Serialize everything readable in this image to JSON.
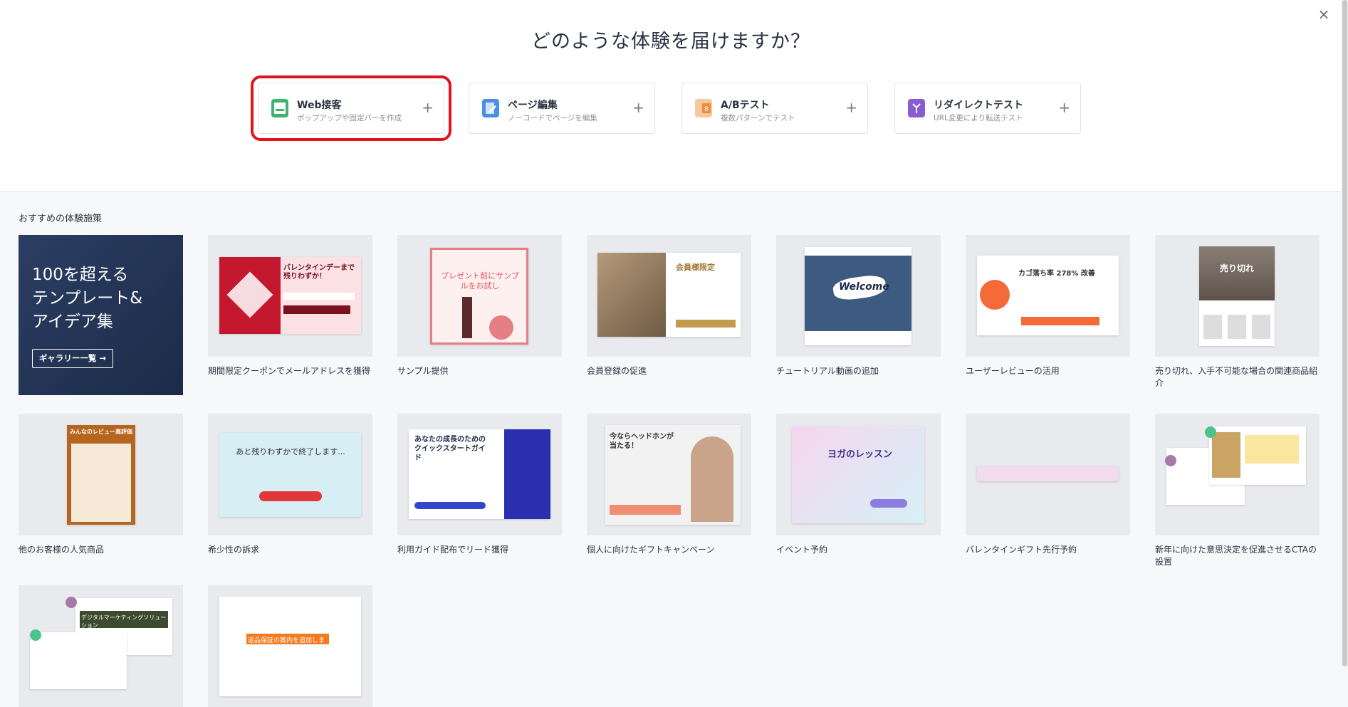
{
  "header": {
    "title": "どのような体験を届けますか？",
    "close_icon": "close-icon"
  },
  "experience_types": [
    {
      "label": "Web接客",
      "sub": "ポップアップや固定バーを作成",
      "icon": "popup-icon",
      "color": "#3cb371",
      "selected": true
    },
    {
      "label": "ページ編集",
      "sub": "ノーコードでページを編集",
      "icon": "page-edit-icon",
      "color": "#4a90e2",
      "selected": false
    },
    {
      "label": "A/Bテスト",
      "sub": "複数パターンでテスト",
      "icon": "ab-test-icon",
      "color": "#f08a3c",
      "selected": false
    },
    {
      "label": "リダイレクトテスト",
      "sub": "URL変更により転送テスト",
      "icon": "redirect-icon",
      "color": "#8a5cd1",
      "selected": false
    }
  ],
  "recommended": {
    "section_title": "おすすめの体験施策",
    "banner": {
      "text": "100を超える\nテンプレート&\nアイデア集",
      "button_label": "ギャラリー一覧 →"
    },
    "templates": [
      {
        "caption": "期間限定クーポンでメールアドレスを獲得",
        "thumb_text": "バレンタインデーまで残りわずか！"
      },
      {
        "caption": "サンプル提供",
        "thumb_text": "プレゼント前にサンプルをお試し"
      },
      {
        "caption": "会員登録の促進",
        "thumb_text": "会員様限定"
      },
      {
        "caption": "チュートリアル動画の追加",
        "thumb_text": "Welcome"
      },
      {
        "caption": "ユーザーレビューの活用",
        "thumb_text": "カゴ落ち率 278% 改善"
      },
      {
        "caption": "売り切れ、入手不可能な場合の関連商品紹介",
        "thumb_text": "売り切れ"
      },
      {
        "caption": "他のお客様の人気商品",
        "thumb_text": "みんなのレビュー高評価"
      },
      {
        "caption": "希少性の訴求",
        "thumb_text": "あと残りわずかで終了します..."
      },
      {
        "caption": "利用ガイド配布でリード獲得",
        "thumb_text": "あなたの成長のためのクイックスタートガイド"
      },
      {
        "caption": "個人に向けたギフトキャンペーン",
        "thumb_text": "今ならヘッドホンが当たる！"
      },
      {
        "caption": "イベント予約",
        "thumb_text": "ヨガのレッスン"
      },
      {
        "caption": "バレンタインギフト先行予約",
        "thumb_text": ""
      },
      {
        "caption": "新年に向けた意思決定を促進させるCTAの設置",
        "thumb_text": ""
      },
      {
        "caption": "",
        "thumb_text": "デジタルマーケティングソリューション"
      },
      {
        "caption": "",
        "thumb_text": "返品保証の案内を追加します"
      }
    ]
  }
}
